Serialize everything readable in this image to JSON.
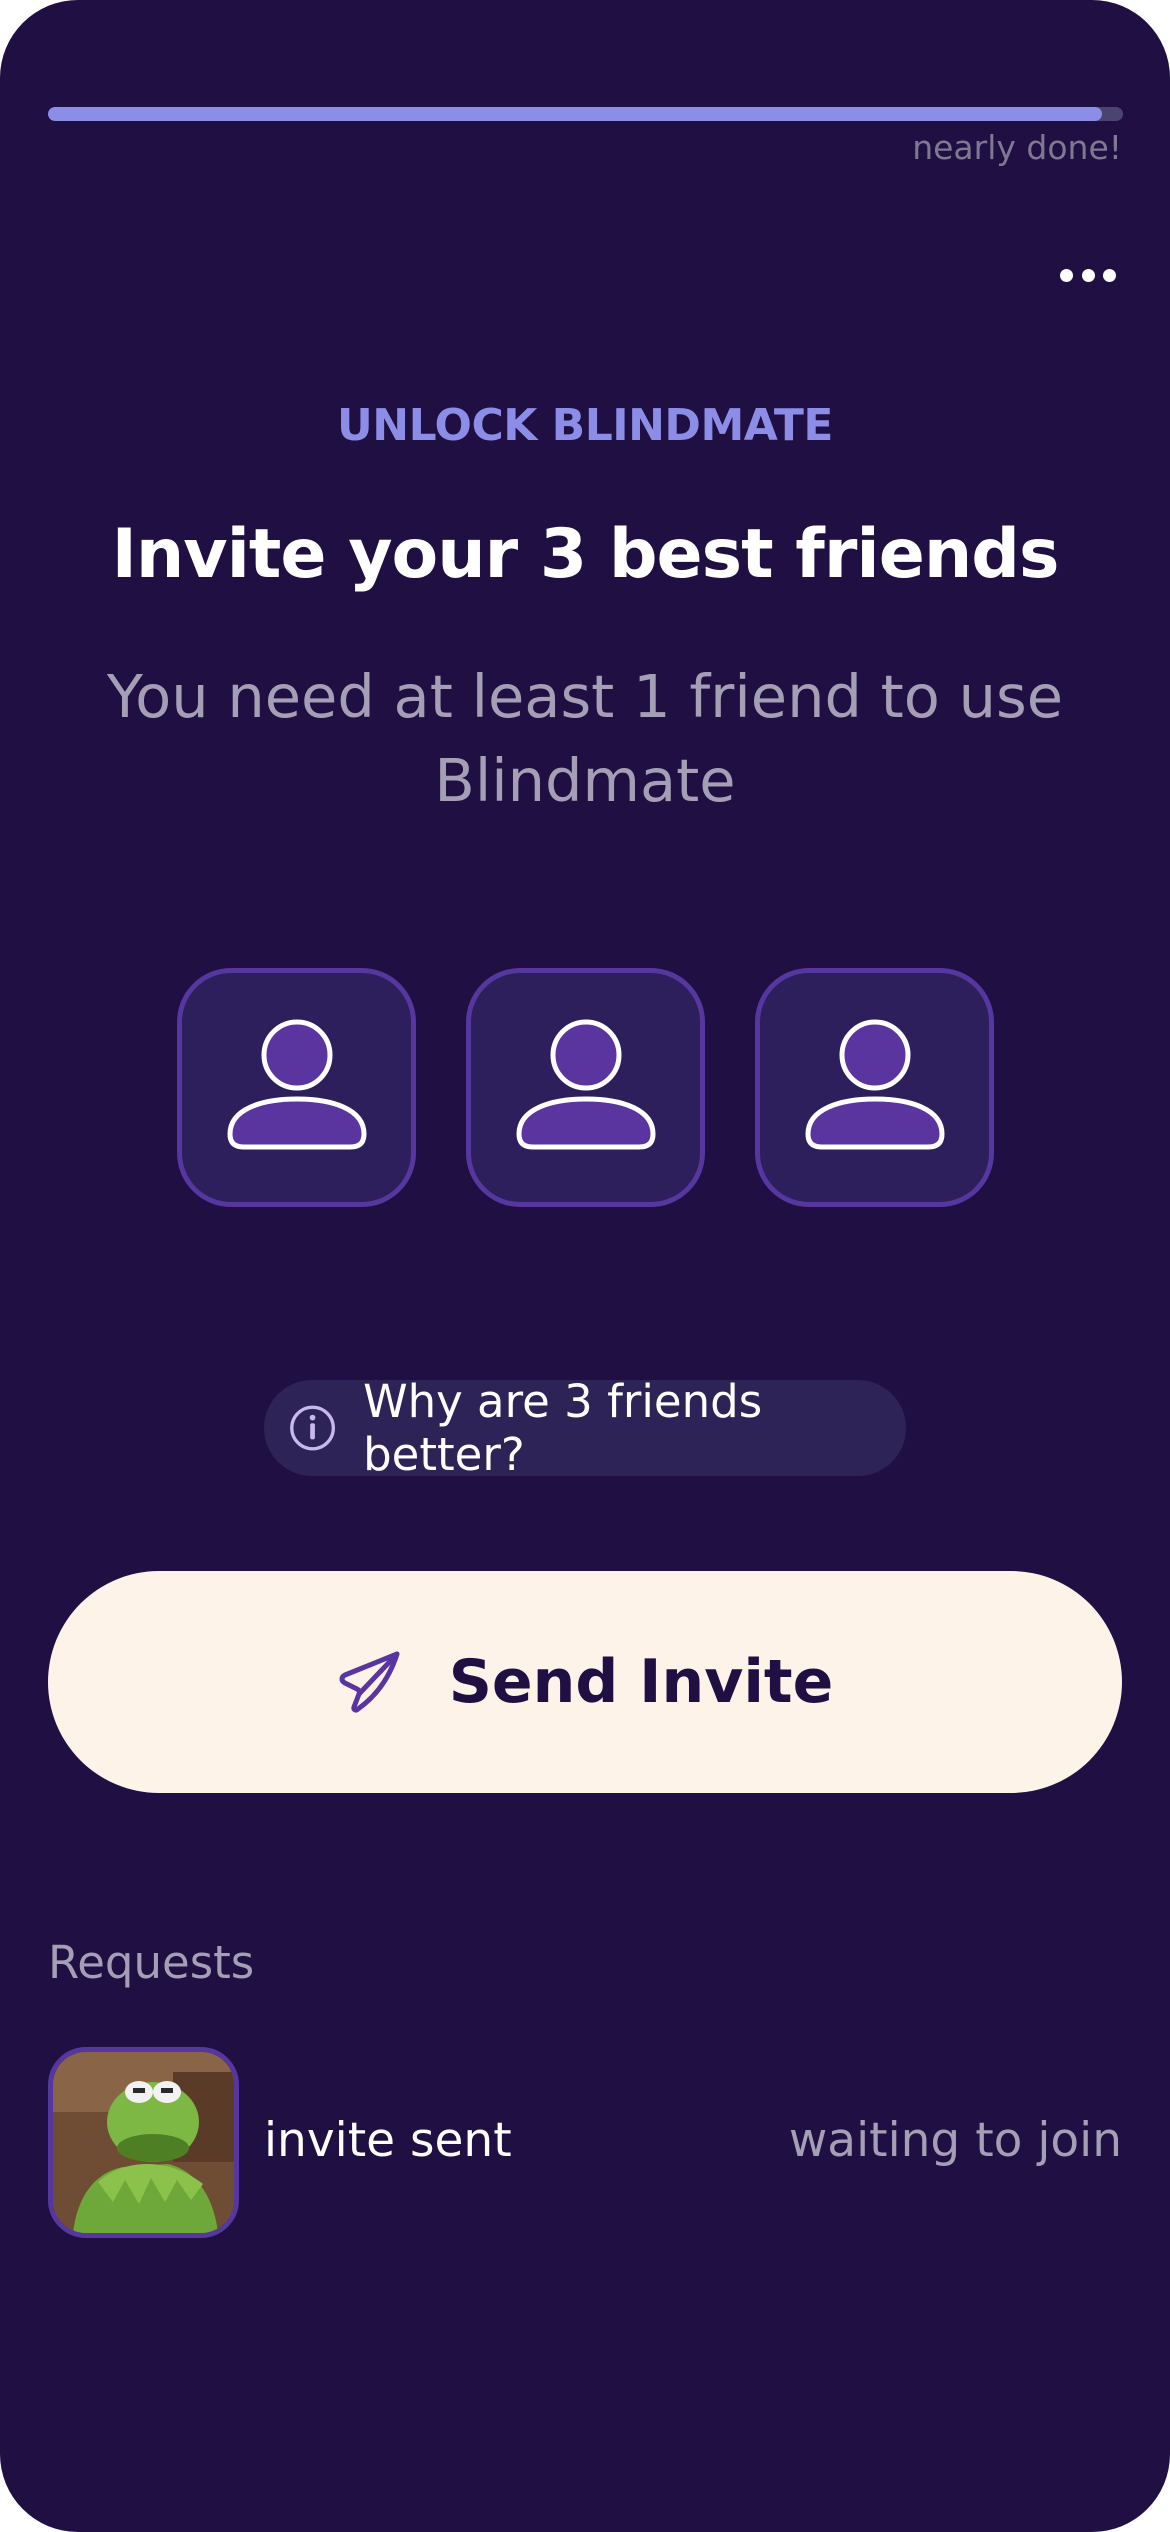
{
  "progress": {
    "value_percent": 98,
    "label": "nearly done!",
    "fill_color": "#8c8de6"
  },
  "header": {
    "more_icon": "more-horizontal-icon"
  },
  "hero": {
    "eyebrow": "UNLOCK BLINDMATE",
    "title": "Invite your 3 best friends",
    "subtitle": "You need at least 1 friend to use Blindmate"
  },
  "friend_slots": [
    {
      "icon": "person-placeholder-icon"
    },
    {
      "icon": "person-placeholder-icon"
    },
    {
      "icon": "person-placeholder-icon"
    }
  ],
  "info": {
    "icon": "info-icon",
    "label": "Why are 3 friends better?"
  },
  "send_button": {
    "icon": "paper-plane-icon",
    "label": "Send Invite"
  },
  "requests": {
    "title": "Requests",
    "items": [
      {
        "avatar": "kermit-avatar",
        "status": "invite sent",
        "state": "waiting to join"
      }
    ]
  },
  "colors": {
    "background": "#1f0f42",
    "accent": "#8c8de6",
    "slot_border": "#55379f",
    "button_bg": "#fdf3e8"
  }
}
